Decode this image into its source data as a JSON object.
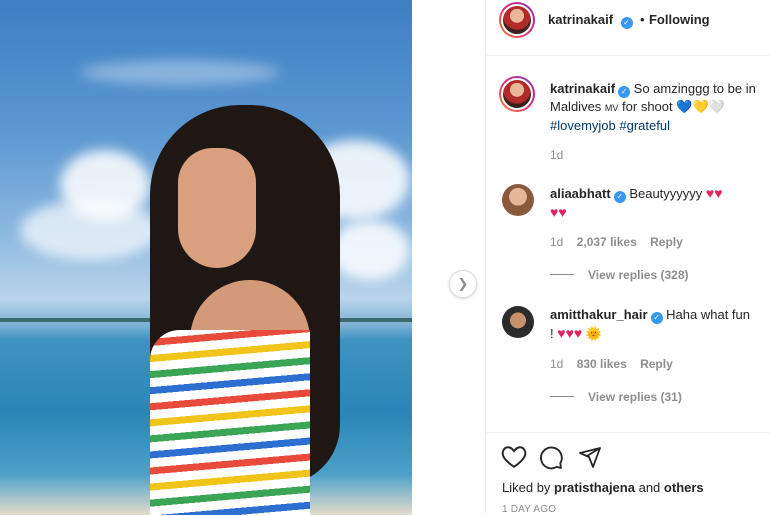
{
  "post": {
    "author": "katrinakaif",
    "follow_sep": "•",
    "follow_status": "Following"
  },
  "caption": {
    "author": "katrinakaif",
    "text_line1": "So amzinggg to be in",
    "text_line2a": "Maldives",
    "text_line2_flag": "MV",
    "text_line2b": "for shoot",
    "hearts": "💙💛🤍",
    "hashtag1": "#lovemyjob",
    "hashtag2": "#grateful",
    "time": "1d"
  },
  "comments": [
    {
      "author": "aliaabhatt",
      "text": "Beautyyyyyy",
      "hearts_line1": "♥♥",
      "hearts_line2": "♥♥",
      "time": "1d",
      "likes": "2,037 likes",
      "reply": "Reply",
      "view_replies": "View replies (328)"
    },
    {
      "author": "amitthakur_hair",
      "text": "Haha what fun",
      "line2_prefix": "!",
      "hearts": "♥♥♥",
      "sun": "🌞",
      "time": "1d",
      "likes": "830 likes",
      "reply": "Reply",
      "view_replies": "View replies (31)"
    }
  ],
  "footer": {
    "liked_by_prefix": "Liked by",
    "liked_by_user": "pratisthajena",
    "liked_by_and": "and",
    "liked_by_others": "others",
    "time_ago": "1 DAY AGO"
  },
  "icons": [
    "heart-icon",
    "comment-icon",
    "share-icon",
    "chevron-right-icon",
    "verified-badge-icon"
  ],
  "colors": {
    "verified": "#3897f0",
    "link": "#00376b",
    "heart": "#e0245e",
    "muted": "#8e8e8e"
  }
}
